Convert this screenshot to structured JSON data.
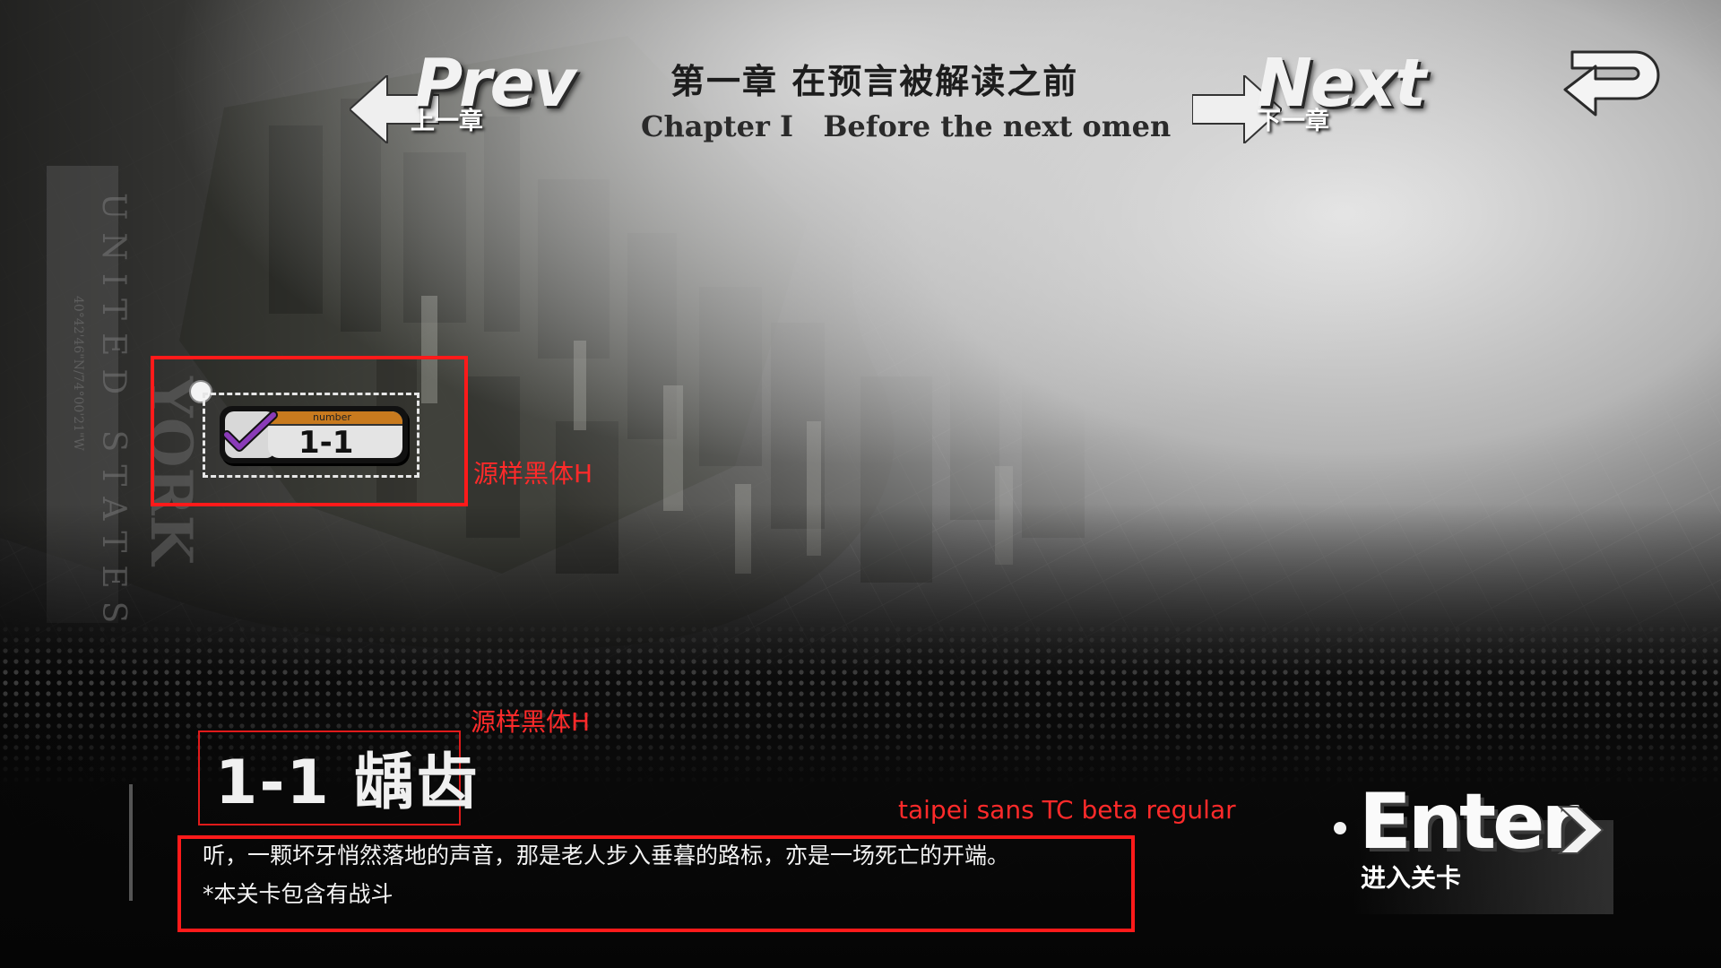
{
  "nav": {
    "prev_big": "Prev",
    "prev_small": "上一章",
    "next_big": "Next",
    "next_small": "下一章"
  },
  "chapter": {
    "title_cn": "第一章 在预言被解读之前",
    "title_en": "Chapter I   Before the next omen"
  },
  "map_labels": {
    "city": "YORK",
    "country": "UNITED STATES",
    "coords": "40°42'46\"N/74°00'21\"W"
  },
  "stage_node": {
    "tag": "number",
    "code": "1-1",
    "cleared": true
  },
  "stage_info": {
    "title": "1-1 龋齿",
    "description": "听，一颗坏牙悄然落地的声音，那是老人步入垂暮的路标，亦是一场死亡的开端。",
    "note": "*本关卡包含有战斗"
  },
  "enter": {
    "big": "Enter",
    "small": "进入关卡"
  },
  "annotations": {
    "font_label_1": "源样黑体H",
    "font_label_2": "源样黑体H",
    "font_label_3": "taipei sans  TC beta regular"
  },
  "colors": {
    "annotation_red": "#ff2a2a",
    "check_purple": "#8a3bb8",
    "tag_orange": "#c87a1e"
  }
}
